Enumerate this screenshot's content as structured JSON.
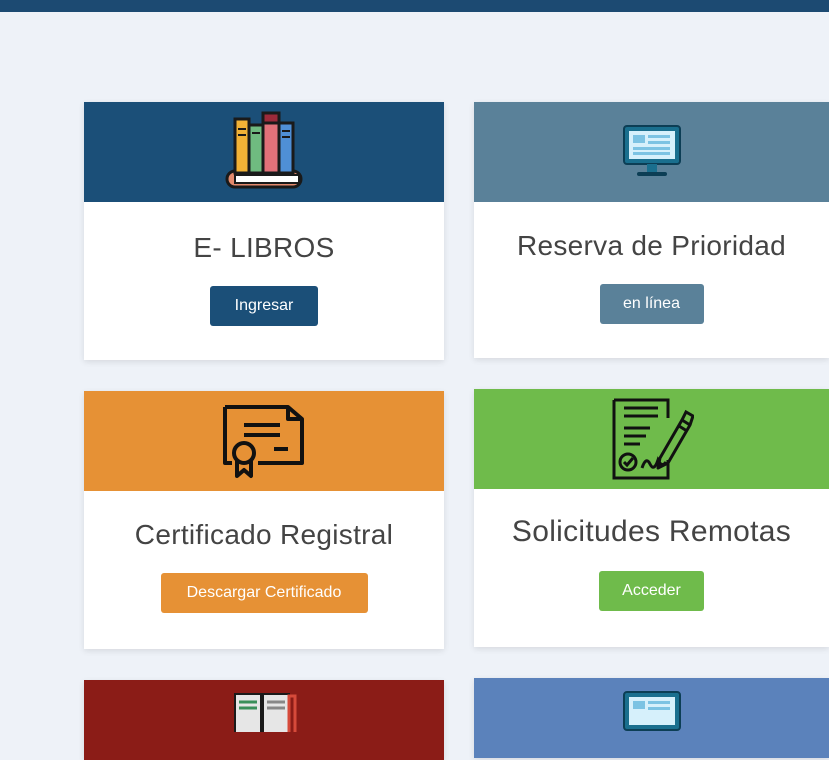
{
  "colors": {
    "top_bar": "#1c4a72",
    "background": "#eef2f8",
    "ebooks": "#1b4f78",
    "reserva": "#5a8199",
    "certificado": "#e69135",
    "solicitudes": "#6fbb4b",
    "card_5": "#8b1c17",
    "card_6": "#5b82bb"
  },
  "cards": [
    {
      "icon": "books-icon",
      "title": "E- LIBROS",
      "button_label": "Ingresar"
    },
    {
      "icon": "monitor-icon",
      "title": "Reserva de Prioridad",
      "button_label": "en línea"
    },
    {
      "icon": "certificate-icon",
      "title": "Certificado Registral",
      "button_label": "Descargar Certificado"
    },
    {
      "icon": "signed-document-icon",
      "title": "Solicitudes Remotas",
      "button_label": "Acceder"
    },
    {
      "icon": "open-book-icon"
    },
    {
      "icon": "monitor-icon"
    }
  ]
}
